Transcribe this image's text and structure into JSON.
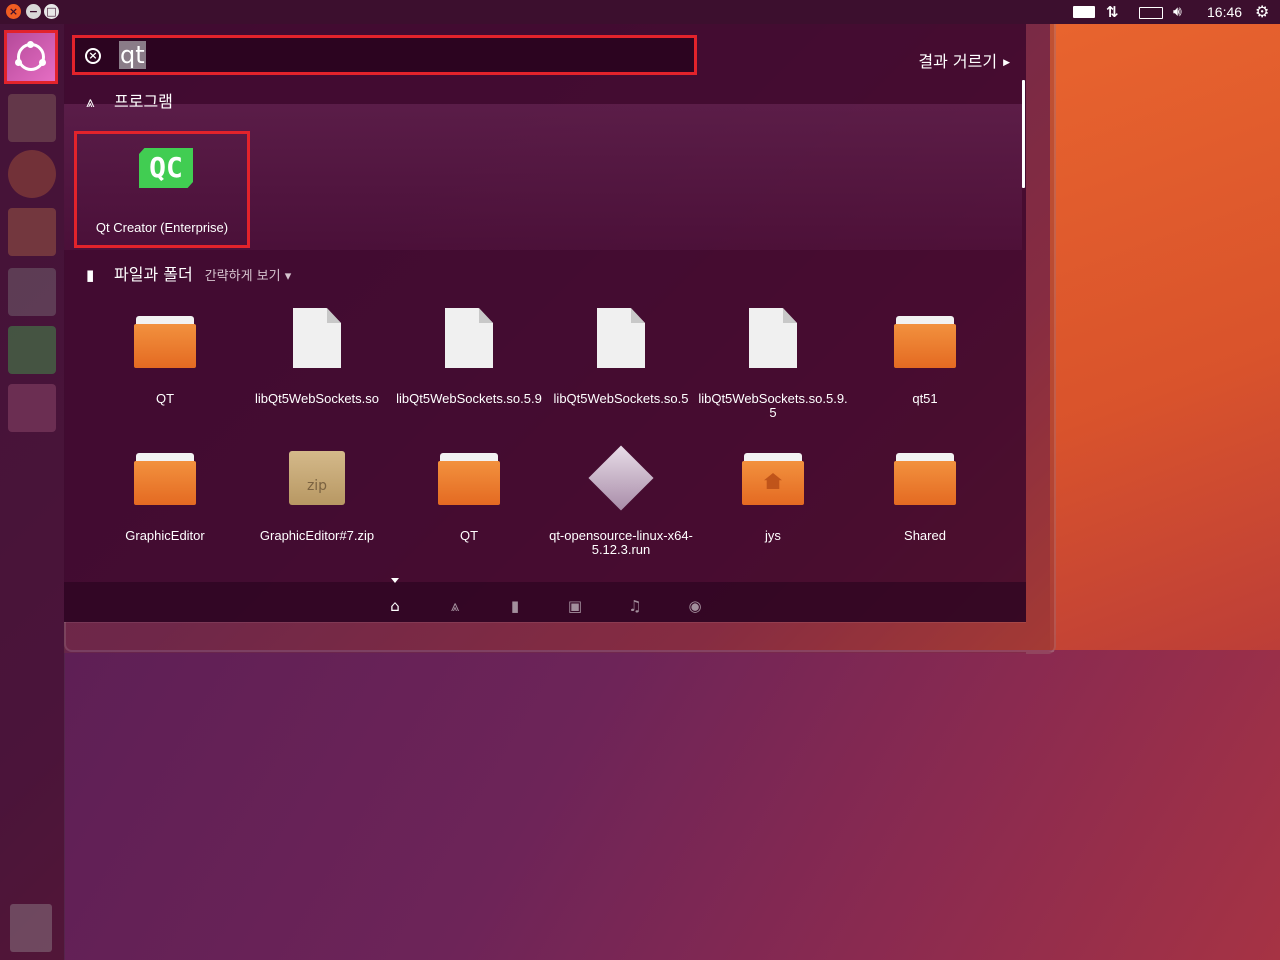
{
  "panel": {
    "clock": "16:46"
  },
  "dash": {
    "search": {
      "query": "qt"
    },
    "filter_label": "결과 거르기",
    "sections": {
      "apps": {
        "title": "프로그램",
        "items": [
          {
            "label": "Qt Creator (Enterprise)",
            "icon": "qt-creator-icon",
            "icon_text": "QC"
          }
        ]
      },
      "files": {
        "title": "파일과 폴더",
        "toggle_label": "간략하게 보기",
        "items": [
          {
            "label": "QT",
            "icon": "folder-icon"
          },
          {
            "label": "libQt5WebSockets.so",
            "icon": "document-icon"
          },
          {
            "label": "libQt5WebSockets.so.5.9",
            "icon": "document-icon"
          },
          {
            "label": "libQt5WebSockets.so.5",
            "icon": "document-icon"
          },
          {
            "label": "libQt5WebSockets.so.5.9.5",
            "icon": "document-icon"
          },
          {
            "label": "qt51",
            "icon": "folder-icon"
          },
          {
            "label": "GraphicEditor",
            "icon": "folder-icon"
          },
          {
            "label": "GraphicEditor#7.zip",
            "icon": "zip-icon",
            "icon_text": "zip"
          },
          {
            "label": "QT",
            "icon": "folder-icon"
          },
          {
            "label": "qt-opensource-linux-x64-5.12.3.run",
            "icon": "installer-icon"
          },
          {
            "label": "jys",
            "icon": "home-folder-icon"
          },
          {
            "label": "Shared",
            "icon": "folder-icon"
          }
        ]
      }
    },
    "lenses": [
      "home-icon",
      "applications-icon",
      "files-icon",
      "video-icon",
      "music-icon",
      "photos-icon"
    ]
  },
  "colors": {
    "highlight": "#e2232b",
    "qt_green": "#41cd52",
    "folder_orange": "#e46a22"
  }
}
